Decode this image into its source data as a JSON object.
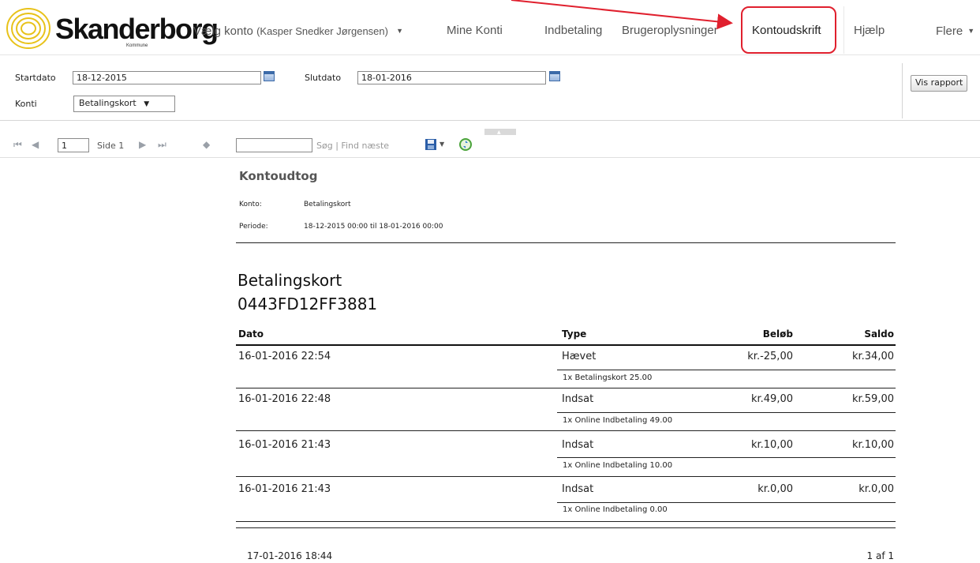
{
  "nav": {
    "brand": "Skanderborg",
    "brand_sub": "Kommune",
    "account_label": "Vælg konto",
    "account_user": "(Kasper Snedker Jørgensen)",
    "items": [
      {
        "label": "Mine Konti"
      },
      {
        "label": "Indbetaling"
      },
      {
        "label": "Brugeroplysninger"
      },
      {
        "label": "Kontoudskrift",
        "active": true
      },
      {
        "label": "Hjælp"
      },
      {
        "label": "Flere"
      }
    ],
    "highlight_color": "#e0202e"
  },
  "params": {
    "start_label": "Startdato",
    "start_value": "18-12-2015",
    "end_label": "Slutdato",
    "end_value": "18-01-2016",
    "account_label": "Konti",
    "account_value": "Betalingskort",
    "run_button": "Vis rapport"
  },
  "toolbar": {
    "page_value": "1",
    "page_text": "Side 1",
    "search_placeholder": "",
    "search_text": "Søg",
    "separator": "|",
    "find_next_text": "Find næste"
  },
  "report": {
    "title": "Kontoudtog",
    "meta": [
      {
        "label": "Konto:",
        "value": "Betalingskort"
      },
      {
        "label": "Periode:",
        "value": "18-12-2015 00:00 til 18-01-2016 00:00"
      }
    ],
    "card_name": "Betalingskort",
    "card_id": "0443FD12FF3881",
    "columns": {
      "date": "Dato",
      "type": "Type",
      "amount": "Beløb",
      "balance": "Saldo"
    },
    "rows": [
      {
        "date": "16-01-2016 22:54",
        "type": "Hævet",
        "amount": "kr.-25,00",
        "balance": "kr.34,00",
        "detail": "1x Betalingskort 25.00"
      },
      {
        "date": "16-01-2016 22:48",
        "type": "Indsat",
        "amount": "kr.49,00",
        "balance": "kr.59,00",
        "detail": "1x Online Indbetaling 49.00"
      },
      {
        "date": "16-01-2016 21:43",
        "type": "Indsat",
        "amount": "kr.10,00",
        "balance": "kr.10,00",
        "detail": "1x Online Indbetaling 10.00"
      },
      {
        "date": "16-01-2016 21:43",
        "type": "Indsat",
        "amount": "kr.0,00",
        "balance": "kr.0,00",
        "detail": "1x Online Indbetaling 0.00"
      }
    ],
    "footer_timestamp": "17-01-2016 18:44",
    "footer_pages": "1 af 1"
  }
}
